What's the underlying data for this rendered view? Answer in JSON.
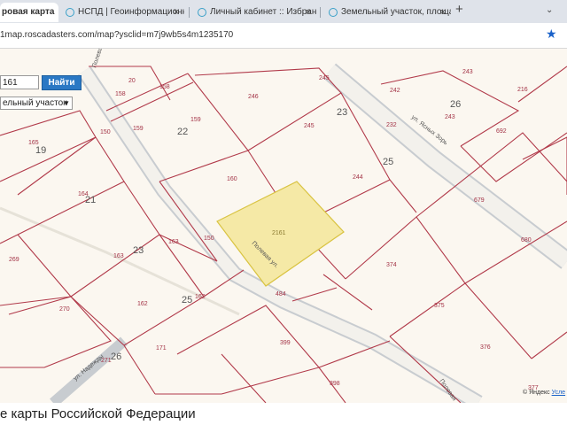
{
  "tabs": [
    {
      "title": "ровая карта",
      "active": true
    },
    {
      "title": "НСПД | Геоинформационный",
      "active": false
    },
    {
      "title": "Личный кабинет :: Избранны",
      "active": false
    },
    {
      "title": "Земельный участок, площадь",
      "active": false
    }
  ],
  "tab_close_glyph": "×",
  "new_tab_glyph": "+",
  "menu_glyph": "⌄",
  "star_glyph": "★",
  "address": "1map.roscadasters.com/map?ysclid=m7j9wb5s4m1235170",
  "search": {
    "value": "161",
    "button": "Найти",
    "type_value": "ельный участок",
    "type_arrow": "▼"
  },
  "map": {
    "highlight_color": "#f5e9a6",
    "highlight_number": "2161",
    "street_label_1": "Полевая ул.",
    "street_label_2": "Полевая ул.",
    "street_label_3": "ул. Ясных Зорь",
    "street_label_4": "ул. Надежды",
    "street_label_5": "Полевая",
    "block_numbers": [
      "19",
      "21",
      "22",
      "23",
      "23",
      "25",
      "25",
      "26",
      "26"
    ],
    "parcels": [
      "20",
      "158",
      "158",
      "150",
      "159",
      "159",
      "165",
      "164",
      "246",
      "245",
      "245",
      "232",
      "242",
      "243",
      "243",
      "216",
      "692",
      "160",
      "244",
      "679",
      "680",
      "269",
      "163",
      "163",
      "150",
      "374",
      "270",
      "162",
      "162",
      "484",
      "375",
      "376",
      "271",
      "171",
      "399",
      "398",
      "377"
    ],
    "scale": "Усле",
    "yandex": "© Яндекс"
  },
  "footer_text": "е карты Российской Федерации"
}
